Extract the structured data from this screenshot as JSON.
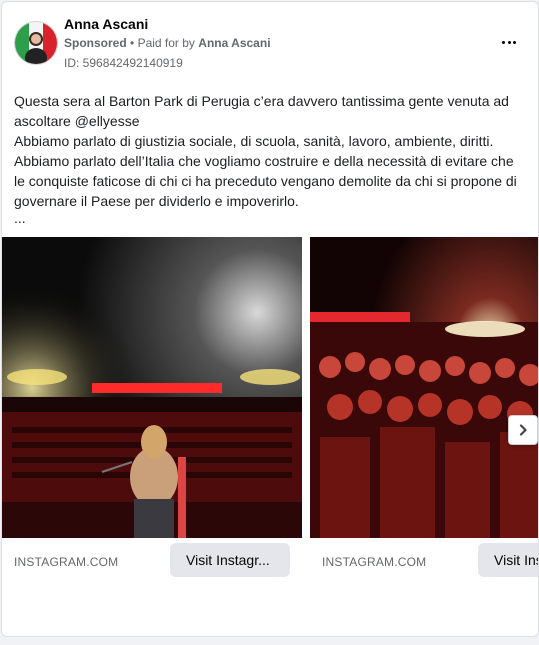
{
  "header": {
    "page_name": "Anna Ascani",
    "sponsored_label": "Sponsored",
    "separator": "•",
    "paid_for_prefix": "Paid for by",
    "paid_for_name": "Anna Ascani",
    "ad_id": "ID: 596842492140919"
  },
  "post": {
    "lines": [
      "Questa sera al Barton Park di Perugia c’era davvero tantissima gente venuta ad ascoltare @ellyesse",
      "Abbiamo parlato di giustizia sociale, di scuola, sanità, lavoro, ambiente, diritti. Abbiamo parlato dell’Italia che vogliamo costruire e della necessità di evitare che le conquiste faticose di chi ci ha preceduto vengano demolite da chi si propone di governare il Paese per dividerlo e impoverirlo."
    ],
    "ellipsis": "..."
  },
  "carousel": {
    "cards": [
      {
        "domain": "INSTAGRAM.COM",
        "cta": "Visit Instagr..."
      },
      {
        "domain": "INSTAGRAM.COM",
        "cta": "Visit Ins"
      }
    ]
  },
  "icons": {
    "more": "more-options-icon",
    "next": "chevron-right-icon"
  },
  "colors": {
    "muted_text": "#65676b",
    "button_bg": "#e4e6eb",
    "stage_red": "#ff2a2a"
  }
}
